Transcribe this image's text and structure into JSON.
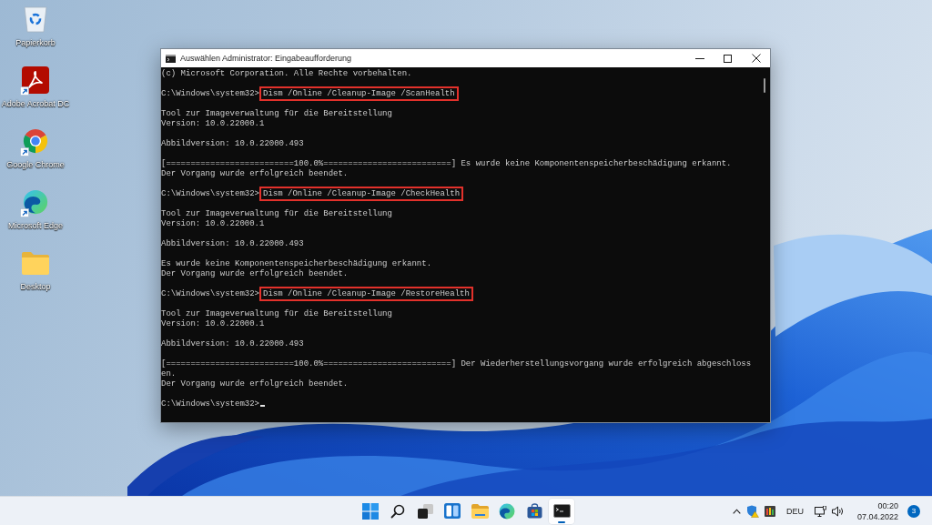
{
  "desktop_icons": [
    {
      "kind": "recycle-bin",
      "label": "Papierkorb",
      "shortcut": false
    },
    {
      "kind": "acrobat",
      "label": "Adobe Acrobat DC",
      "shortcut": true
    },
    {
      "kind": "chrome",
      "label": "Google Chrome",
      "shortcut": true
    },
    {
      "kind": "edge",
      "label": "Microsoft Edge",
      "shortcut": true
    },
    {
      "kind": "folder",
      "label": "Desktop",
      "shortcut": false
    }
  ],
  "window": {
    "title": "Auswählen Administrator: Eingabeaufforderung",
    "console": {
      "blocks": [
        {
          "lines": [
            {
              "kind": "text",
              "text": "(c) Microsoft Corporation. Alle Rechte vorbehalten."
            }
          ]
        },
        {
          "lines": [
            {
              "kind": "command",
              "prompt": "C:\\Windows\\system32>",
              "command": "Dism /Online /Cleanup-Image /ScanHealth",
              "highlighted": true
            }
          ]
        },
        {
          "lines": [
            {
              "kind": "text",
              "text": "Tool zur Imageverwaltung für die Bereitstellung"
            },
            {
              "kind": "text",
              "text": "Version: 10.0.22000.1"
            }
          ]
        },
        {
          "lines": [
            {
              "kind": "text",
              "text": "Abbildversion: 10.0.22000.493"
            }
          ]
        },
        {
          "lines": [
            {
              "kind": "text",
              "text": "[==========================100.0%==========================] Es wurde keine Komponentenspeicherbeschädigung erkannt."
            },
            {
              "kind": "text",
              "text": "Der Vorgang wurde erfolgreich beendet."
            }
          ]
        },
        {
          "lines": [
            {
              "kind": "command",
              "prompt": "C:\\Windows\\system32>",
              "command": "Dism /Online /Cleanup-Image /CheckHealth",
              "highlighted": true
            }
          ]
        },
        {
          "lines": [
            {
              "kind": "text",
              "text": "Tool zur Imageverwaltung für die Bereitstellung"
            },
            {
              "kind": "text",
              "text": "Version: 10.0.22000.1"
            }
          ]
        },
        {
          "lines": [
            {
              "kind": "text",
              "text": "Abbildversion: 10.0.22000.493"
            }
          ]
        },
        {
          "lines": [
            {
              "kind": "text",
              "text": "Es wurde keine Komponentenspeicherbeschädigung erkannt."
            },
            {
              "kind": "text",
              "text": "Der Vorgang wurde erfolgreich beendet."
            }
          ]
        },
        {
          "lines": [
            {
              "kind": "command",
              "prompt": "C:\\Windows\\system32>",
              "command": "Dism /Online /Cleanup-Image /RestoreHealth",
              "highlighted": true
            }
          ]
        },
        {
          "lines": [
            {
              "kind": "text",
              "text": "Tool zur Imageverwaltung für die Bereitstellung"
            },
            {
              "kind": "text",
              "text": "Version: 10.0.22000.1"
            }
          ]
        },
        {
          "lines": [
            {
              "kind": "text",
              "text": "Abbildversion: 10.0.22000.493"
            }
          ]
        },
        {
          "lines": [
            {
              "kind": "text",
              "text": "[==========================100.0%==========================] Der Wiederherstellungsvorgang wurde erfolgreich abgeschloss"
            },
            {
              "kind": "text",
              "text": "en."
            },
            {
              "kind": "text",
              "text": "Der Vorgang wurde erfolgreich beendet."
            }
          ]
        },
        {
          "lines": [
            {
              "kind": "input",
              "prompt": "C:\\Windows\\system32>",
              "cursor": true
            }
          ]
        }
      ]
    }
  },
  "taskbar": {
    "apps": [
      {
        "kind": "start",
        "selected": false
      },
      {
        "kind": "search",
        "selected": false
      },
      {
        "kind": "task-view",
        "selected": false
      },
      {
        "kind": "widgets",
        "selected": false
      },
      {
        "kind": "explorer",
        "selected": false
      },
      {
        "kind": "edge",
        "selected": false
      },
      {
        "kind": "store",
        "selected": false
      },
      {
        "kind": "terminal",
        "selected": true
      }
    ],
    "tray": {
      "language": "DEU",
      "time": "00:20",
      "date": "07.04.2022",
      "notifications": "3"
    }
  }
}
